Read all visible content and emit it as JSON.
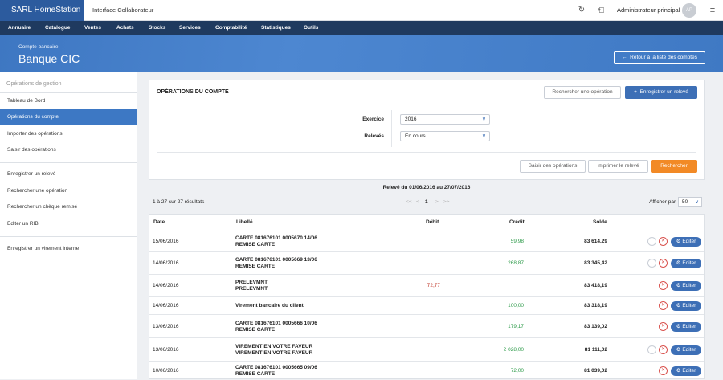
{
  "topbar": {
    "brand": "SARL HomeStation",
    "subtitle": "Interface Collaborateur",
    "user": "Administrateur principal",
    "avatar": "AP",
    "icons": [
      "sync-icon",
      "export-icon",
      "hamburger-icon"
    ]
  },
  "menu": [
    "Annuaire",
    "Catalogue",
    "Ventes",
    "Achats",
    "Stocks",
    "Services",
    "Comptabilité",
    "Statistiques",
    "Outils"
  ],
  "hero": {
    "small": "Compte bancaire",
    "title": "Banque CIC",
    "back": "Retour à la liste des comptes"
  },
  "sidebar": {
    "title": "Opérations de gestion",
    "group1": [
      "Tableau de Bord",
      "Opérations du compte",
      "Importer des opérations",
      "Saisir des opérations"
    ],
    "group2": [
      "Enregistrer un relevé",
      "Rechercher une opération",
      "Rechercher un chèque remisé",
      "Editer un RIB"
    ],
    "group3": [
      "Enregistrer un virement interne"
    ],
    "active": "Opérations du compte"
  },
  "panel": {
    "title": "OPÉRATIONS DU COMPTE",
    "search_btn": "Rechercher une opération",
    "register_btn": "Enregistrer un relevé",
    "exercice_label": "Exercice",
    "exercice_value": "2016",
    "releves_label": "Relevés",
    "releves_value": "En cours",
    "saisir_btn": "Saisir des opérations",
    "print_btn": "Imprimer le relevé",
    "rechercher_btn": "Rechercher"
  },
  "releve_title": "Relevé du 01/06/2016 au 27/07/2016",
  "pagination": {
    "count": "1 à 27 sur 27 résultats",
    "first": "<<",
    "prev": "<",
    "page": "1",
    "next": ">",
    "last": ">>",
    "per_page_label": "Afficher par",
    "per_page": "50"
  },
  "table": {
    "headers": {
      "date": "Date",
      "libelle": "Libellé",
      "debit": "Débit",
      "credit": "Crédit",
      "solde": "Solde"
    },
    "edit_label": "Editer",
    "rows": [
      {
        "date": "15/06/2016",
        "lib1": "CARTE 081676101 0005670 14/06",
        "lib2": "REMISE CARTE",
        "debit": "",
        "credit": "59,98",
        "solde": "83 614,29",
        "info": true
      },
      {
        "date": "14/06/2016",
        "lib1": "CARTE 081676101 0005669 13/06",
        "lib2": "REMISE CARTE",
        "debit": "",
        "credit": "268,87",
        "solde": "83 345,42",
        "info": true
      },
      {
        "date": "14/06/2016",
        "lib1": "PRELEVMNT",
        "lib2": "PRELEVMNT",
        "debit": "72,77",
        "credit": "",
        "solde": "83 418,19",
        "info": false
      },
      {
        "date": "14/06/2016",
        "lib1": "Virement bancaire du client",
        "lib2": "",
        "debit": "",
        "credit": "100,00",
        "solde": "83 318,19",
        "info": false
      },
      {
        "date": "13/06/2016",
        "lib1": "CARTE 081676101 0005666 10/06",
        "lib2": "REMISE CARTE",
        "debit": "",
        "credit": "179,17",
        "solde": "83 139,02",
        "info": false
      },
      {
        "date": "13/06/2016",
        "lib1": "VIREMENT EN VOTRE FAVEUR",
        "lib2": "VIREMENT EN VOTRE FAVEUR",
        "debit": "",
        "credit": "2 028,00",
        "solde": "81 111,02",
        "info": true
      },
      {
        "date": "10/06/2016",
        "lib1": "CARTE 081676101 0005665 09/06",
        "lib2": "REMISE CARTE",
        "debit": "",
        "credit": "72,00",
        "solde": "81 039,02",
        "info": false
      }
    ]
  }
}
